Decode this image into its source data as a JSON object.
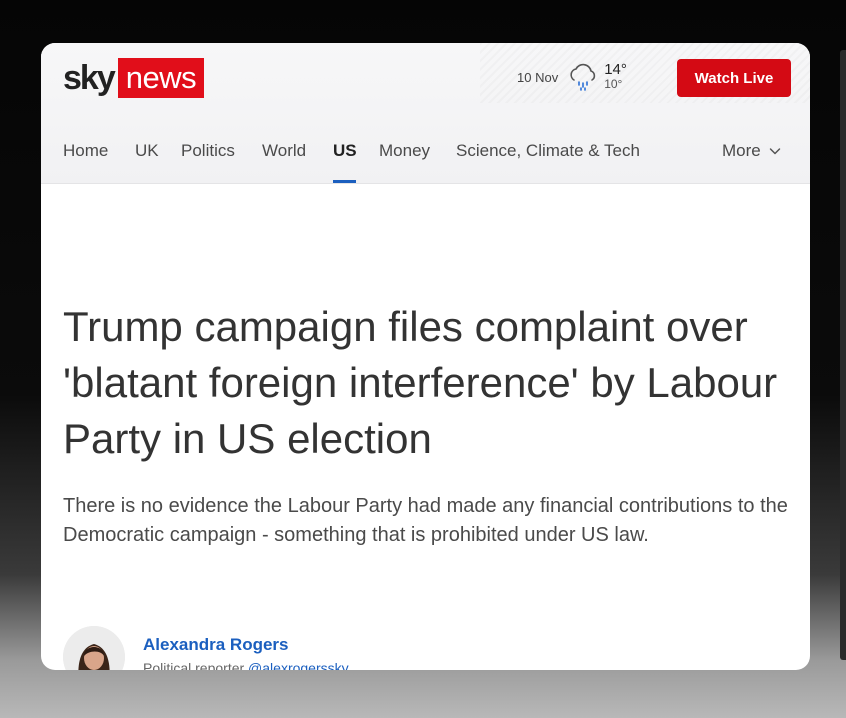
{
  "brand": {
    "sky": "sky",
    "news": "news",
    "accent_color": "#e10e1a"
  },
  "weather": {
    "date": "10 Nov",
    "high": "14°",
    "low": "10°",
    "icon": "rain-cloud-icon"
  },
  "header": {
    "watch_live": "Watch Live"
  },
  "nav": {
    "items": [
      {
        "label": "Home",
        "active": false
      },
      {
        "label": "UK",
        "active": false
      },
      {
        "label": "Politics",
        "active": false
      },
      {
        "label": "World",
        "active": false
      },
      {
        "label": "US",
        "active": true
      },
      {
        "label": "Money",
        "active": false
      },
      {
        "label": "Science, Climate & Tech",
        "active": false
      }
    ],
    "more": "More"
  },
  "article": {
    "headline": "Trump campaign files complaint over 'blatant foreign interference' by Labour Party in US election",
    "standfirst": "There is no evidence the Labour Party had made any financial contributions to the Democratic campaign - something that is prohibited under US law."
  },
  "author": {
    "name": "Alexandra Rogers",
    "role": "Political reporter",
    "handle": "@alexrogerssky"
  }
}
